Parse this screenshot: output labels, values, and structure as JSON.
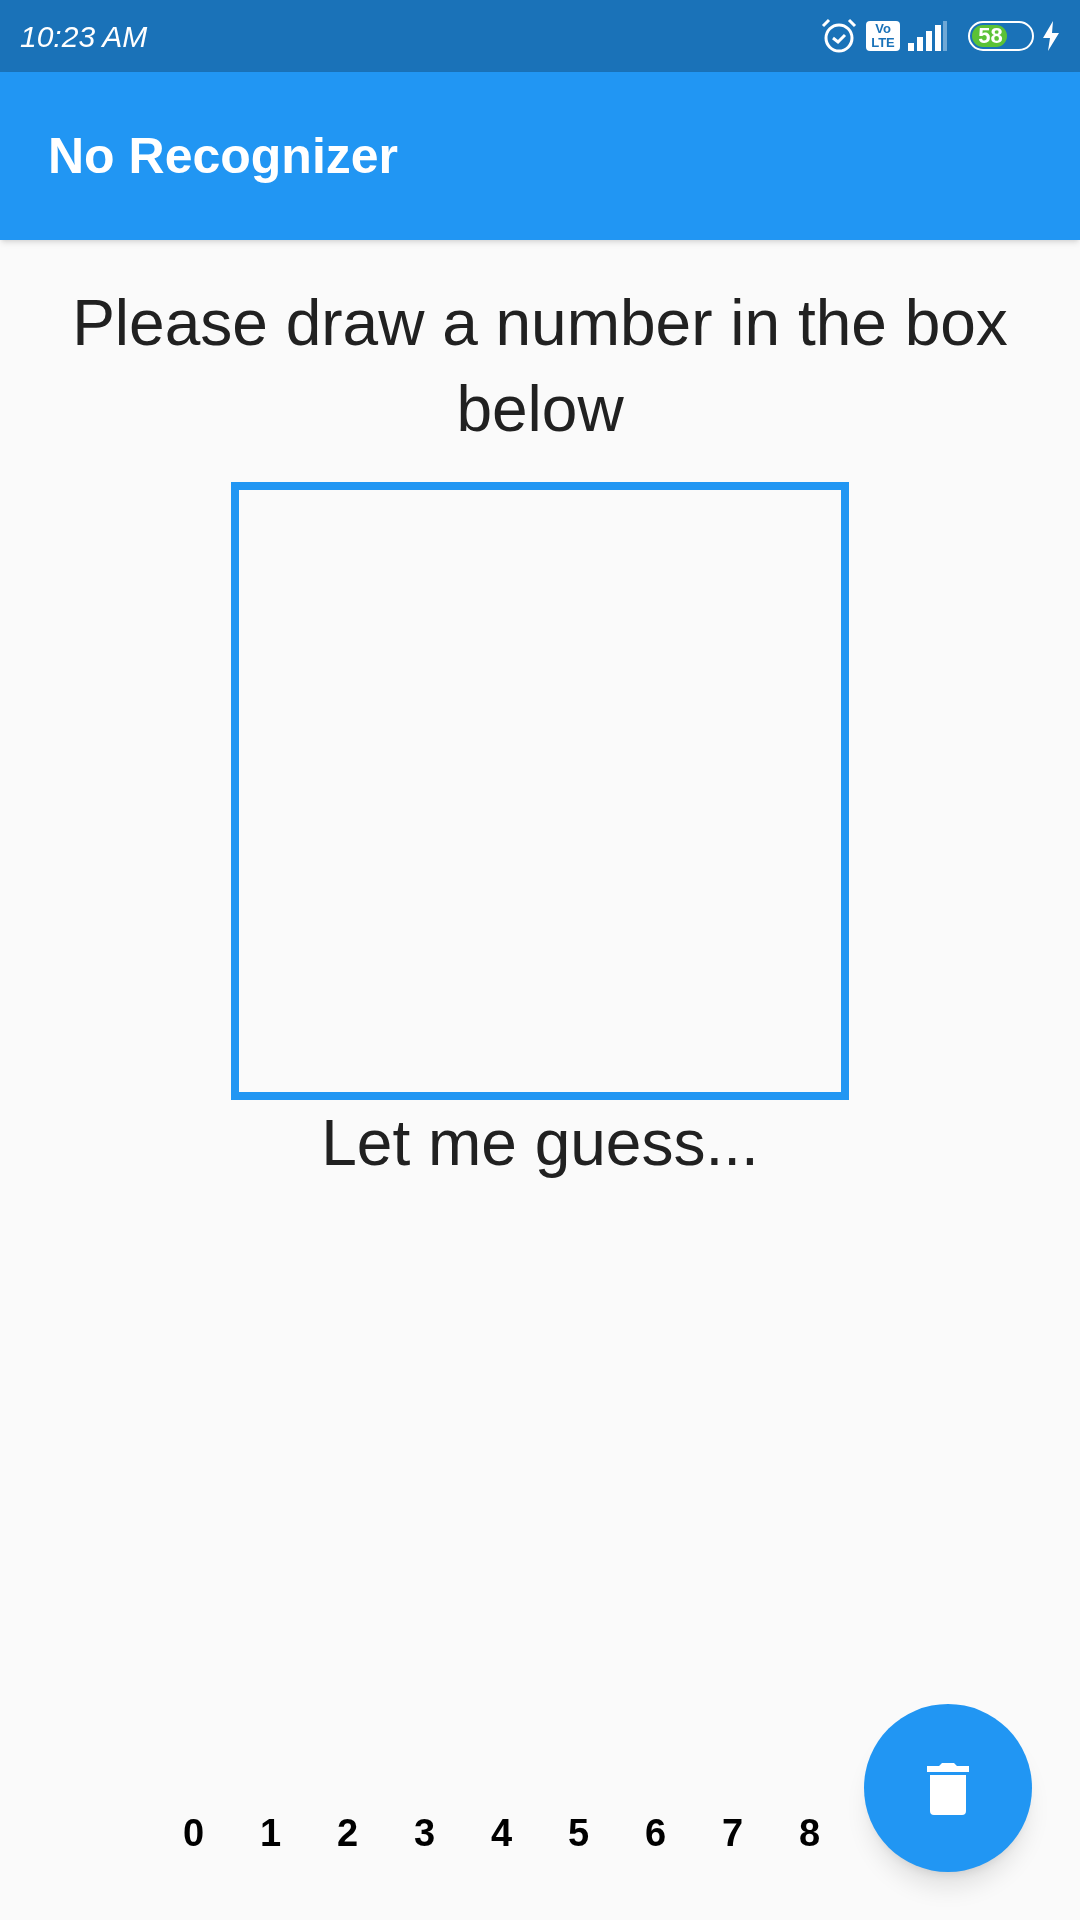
{
  "status_bar": {
    "time": "10:23 AM",
    "volte": "Vo LTE",
    "battery": "58"
  },
  "app_bar": {
    "title": "No Recognizer"
  },
  "prompt": "Please draw a number in the box below",
  "guess": "Let me guess...",
  "digits": [
    "0",
    "1",
    "2",
    "3",
    "4",
    "5",
    "6",
    "7",
    "8"
  ],
  "fab": {
    "kind": "delete"
  }
}
